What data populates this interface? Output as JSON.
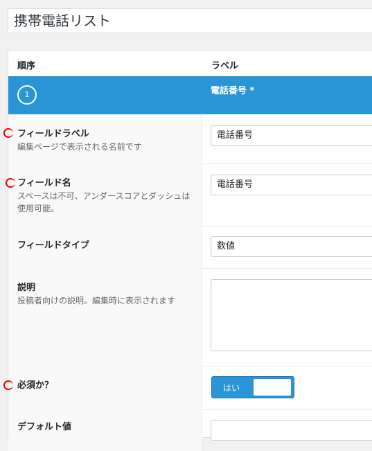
{
  "title": {
    "value": "携帯電話リスト"
  },
  "table": {
    "col_order": "順序",
    "col_label": "ラベル"
  },
  "field": {
    "order": "1",
    "label": "電話番号 *"
  },
  "rows": {
    "field_label": {
      "label": "フィールドラベル",
      "desc": "編集ページで表示される名前です",
      "value": "電話番号"
    },
    "field_name": {
      "label": "フィールド名",
      "desc": "スペースは不可、アンダースコアとダッシュは使用可能。",
      "value": "電話番号"
    },
    "field_type": {
      "label": "フィールドタイプ",
      "value": "数値"
    },
    "instructions": {
      "label": "説明",
      "desc": "投稿者向けの説明。編集時に表示されます",
      "value": ""
    },
    "required": {
      "label": "必須か？",
      "toggle_on": "はい"
    },
    "default_value": {
      "label": "デフォルト値"
    }
  },
  "colors": {
    "accent": "#2a95d5",
    "annotation": "#e00000"
  }
}
